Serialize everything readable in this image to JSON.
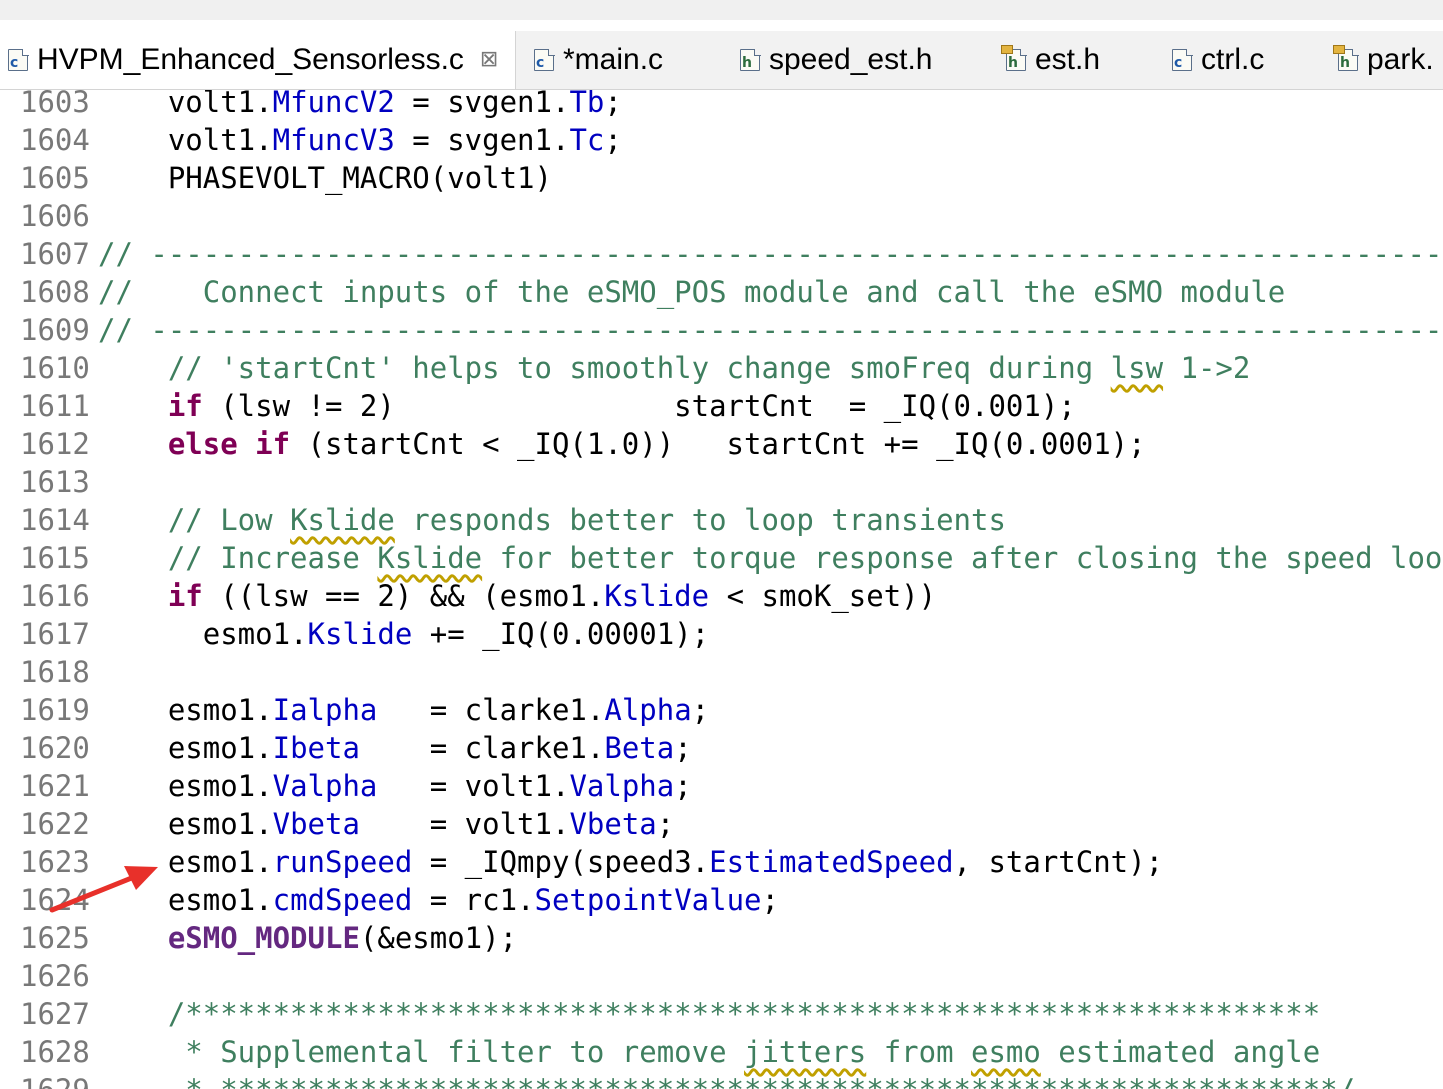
{
  "tabs": [
    {
      "label": "HVPM_Enhanced_Sensorless.c",
      "icon": "c-file-icon",
      "glyph": "c",
      "linked": false,
      "active": true,
      "closable": true
    },
    {
      "label": "*main.c",
      "icon": "c-file-icon",
      "glyph": "c",
      "linked": false,
      "active": false
    },
    {
      "label": "speed_est.h",
      "icon": "h-file-icon",
      "glyph": "h",
      "linked": false,
      "active": false
    },
    {
      "label": "est.h",
      "icon": "h-file-icon",
      "glyph": "h",
      "linked": true,
      "active": false
    },
    {
      "label": "ctrl.c",
      "icon": "c-file-icon",
      "glyph": "c",
      "linked": false,
      "active": false
    },
    {
      "label": "park.",
      "icon": "h-file-icon",
      "glyph": "h",
      "linked": true,
      "active": false
    }
  ],
  "close_glyph": "⊠",
  "colors": {
    "keyword": "#7f0055",
    "field": "#0000c0",
    "comment": "#3f7f5f",
    "macro": "#642880",
    "line_number": "#787878",
    "annotation_arrow": "#e8302a"
  },
  "annotation": {
    "icon": "red-arrow-icon",
    "points_to_line": "1623"
  },
  "lines": [
    {
      "n": "1603",
      "t": [
        {
          "s": "    volt1."
        },
        {
          "s": "MfuncV2",
          "c": "field"
        },
        {
          "s": " = svgen1."
        },
        {
          "s": "Tb",
          "c": "field"
        },
        {
          "s": ";"
        }
      ]
    },
    {
      "n": "1604",
      "t": [
        {
          "s": "    volt1."
        },
        {
          "s": "MfuncV3",
          "c": "field"
        },
        {
          "s": " = svgen1."
        },
        {
          "s": "Tc",
          "c": "field"
        },
        {
          "s": ";"
        }
      ]
    },
    {
      "n": "1605",
      "t": [
        {
          "s": "    PHASEVOLT_MACRO(volt1)"
        }
      ]
    },
    {
      "n": "1606",
      "t": []
    },
    {
      "n": "1607",
      "t": [
        {
          "s": "// ---------------------------------------------------------------------------",
          "c": "com"
        }
      ]
    },
    {
      "n": "1608",
      "t": [
        {
          "s": "//    Connect inputs of the eSMO_POS module and call the eSMO module",
          "c": "com"
        }
      ]
    },
    {
      "n": "1609",
      "t": [
        {
          "s": "// ---------------------------------------------------------------------------",
          "c": "com"
        }
      ]
    },
    {
      "n": "1610",
      "t": [
        {
          "s": "    // 'startCnt' helps to smoothly change smoFreq during ",
          "c": "com"
        },
        {
          "s": "lsw",
          "c": "com sq"
        },
        {
          "s": " 1->2",
          "c": "com"
        }
      ]
    },
    {
      "n": "1611",
      "t": [
        {
          "s": "    "
        },
        {
          "s": "if",
          "c": "kw"
        },
        {
          "s": " (lsw != 2)                startCnt  = _IQ(0.001);"
        }
      ]
    },
    {
      "n": "1612",
      "t": [
        {
          "s": "    "
        },
        {
          "s": "else if",
          "c": "kw"
        },
        {
          "s": " (startCnt < _IQ(1.0))   startCnt += _IQ(0.0001);"
        }
      ]
    },
    {
      "n": "1613",
      "t": []
    },
    {
      "n": "1614",
      "t": [
        {
          "s": "    // Low ",
          "c": "com"
        },
        {
          "s": "Kslide",
          "c": "com sq"
        },
        {
          "s": " responds better to loop transients",
          "c": "com"
        }
      ]
    },
    {
      "n": "1615",
      "t": [
        {
          "s": "    // Increase ",
          "c": "com"
        },
        {
          "s": "Kslide",
          "c": "com sq"
        },
        {
          "s": " for better torque response after closing the speed loop",
          "c": "com"
        }
      ]
    },
    {
      "n": "1616",
      "t": [
        {
          "s": "    "
        },
        {
          "s": "if",
          "c": "kw"
        },
        {
          "s": " ((lsw == 2) && (esmo1."
        },
        {
          "s": "Kslide",
          "c": "field"
        },
        {
          "s": " < smoK_set))"
        }
      ]
    },
    {
      "n": "1617",
      "t": [
        {
          "s": "      esmo1."
        },
        {
          "s": "Kslide",
          "c": "field"
        },
        {
          "s": " += _IQ(0.00001);"
        }
      ]
    },
    {
      "n": "1618",
      "t": []
    },
    {
      "n": "1619",
      "t": [
        {
          "s": "    esmo1."
        },
        {
          "s": "Ialpha",
          "c": "field"
        },
        {
          "s": "   = clarke1."
        },
        {
          "s": "Alpha",
          "c": "field"
        },
        {
          "s": ";"
        }
      ]
    },
    {
      "n": "1620",
      "t": [
        {
          "s": "    esmo1."
        },
        {
          "s": "Ibeta",
          "c": "field"
        },
        {
          "s": "    = clarke1."
        },
        {
          "s": "Beta",
          "c": "field"
        },
        {
          "s": ";"
        }
      ]
    },
    {
      "n": "1621",
      "t": [
        {
          "s": "    esmo1."
        },
        {
          "s": "Valpha",
          "c": "field"
        },
        {
          "s": "   = volt1."
        },
        {
          "s": "Valpha",
          "c": "field"
        },
        {
          "s": ";"
        }
      ]
    },
    {
      "n": "1622",
      "t": [
        {
          "s": "    esmo1."
        },
        {
          "s": "Vbeta",
          "c": "field"
        },
        {
          "s": "    = volt1."
        },
        {
          "s": "Vbeta",
          "c": "field"
        },
        {
          "s": ";"
        }
      ]
    },
    {
      "n": "1623",
      "t": [
        {
          "s": "    esmo1."
        },
        {
          "s": "runSpeed",
          "c": "field"
        },
        {
          "s": " = _IQmpy(speed3."
        },
        {
          "s": "EstimatedSpeed",
          "c": "field"
        },
        {
          "s": ", startCnt);"
        }
      ]
    },
    {
      "n": "1624",
      "t": [
        {
          "s": "    esmo1."
        },
        {
          "s": "cmdSpeed",
          "c": "field"
        },
        {
          "s": " = rc1."
        },
        {
          "s": "SetpointValue",
          "c": "field"
        },
        {
          "s": ";"
        }
      ]
    },
    {
      "n": "1625",
      "t": [
        {
          "s": "    "
        },
        {
          "s": "eSMO_MODULE",
          "c": "macro"
        },
        {
          "s": "(&esmo1);"
        }
      ]
    },
    {
      "n": "1626",
      "t": []
    },
    {
      "n": "1627",
      "t": [
        {
          "s": "    /*****************************************************************",
          "c": "com"
        }
      ]
    },
    {
      "n": "1628",
      "t": [
        {
          "s": "     * Supplemental filter to remove ",
          "c": "com"
        },
        {
          "s": "jitters",
          "c": "com sq"
        },
        {
          "s": " from ",
          "c": "com"
        },
        {
          "s": "esmo",
          "c": "com sq"
        },
        {
          "s": " estimated angle",
          "c": "com"
        }
      ]
    },
    {
      "n": "1629",
      "t": [
        {
          "s": "     * ****************************************************************/",
          "c": "com"
        }
      ]
    }
  ]
}
